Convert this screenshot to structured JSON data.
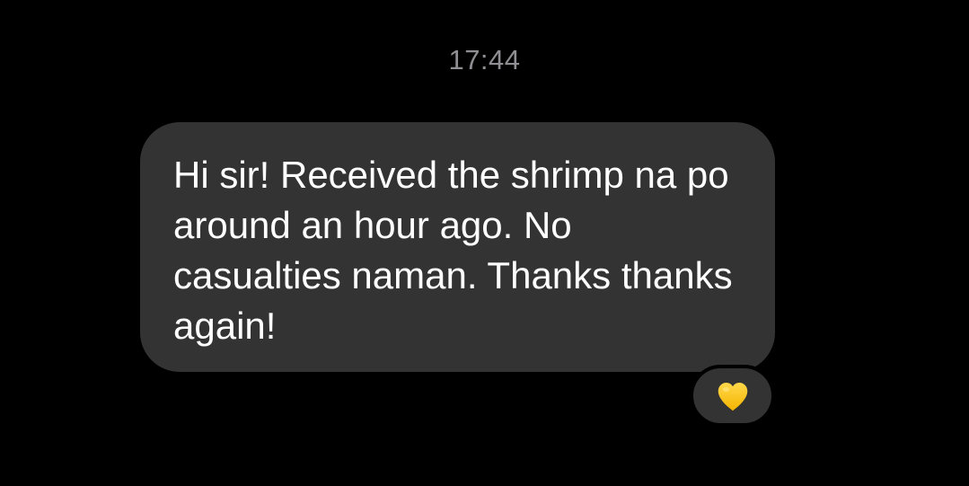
{
  "conversation": {
    "timestamp": "17:44",
    "message": {
      "text": "Hi sir! Received the shrimp na po around an hour ago. No casualties naman. Thanks thanks again!",
      "bubble_color": "#333333",
      "text_color": "#ffffff"
    },
    "reaction": {
      "icon": "yellow-heart-icon",
      "color": "#ffcc00"
    }
  }
}
